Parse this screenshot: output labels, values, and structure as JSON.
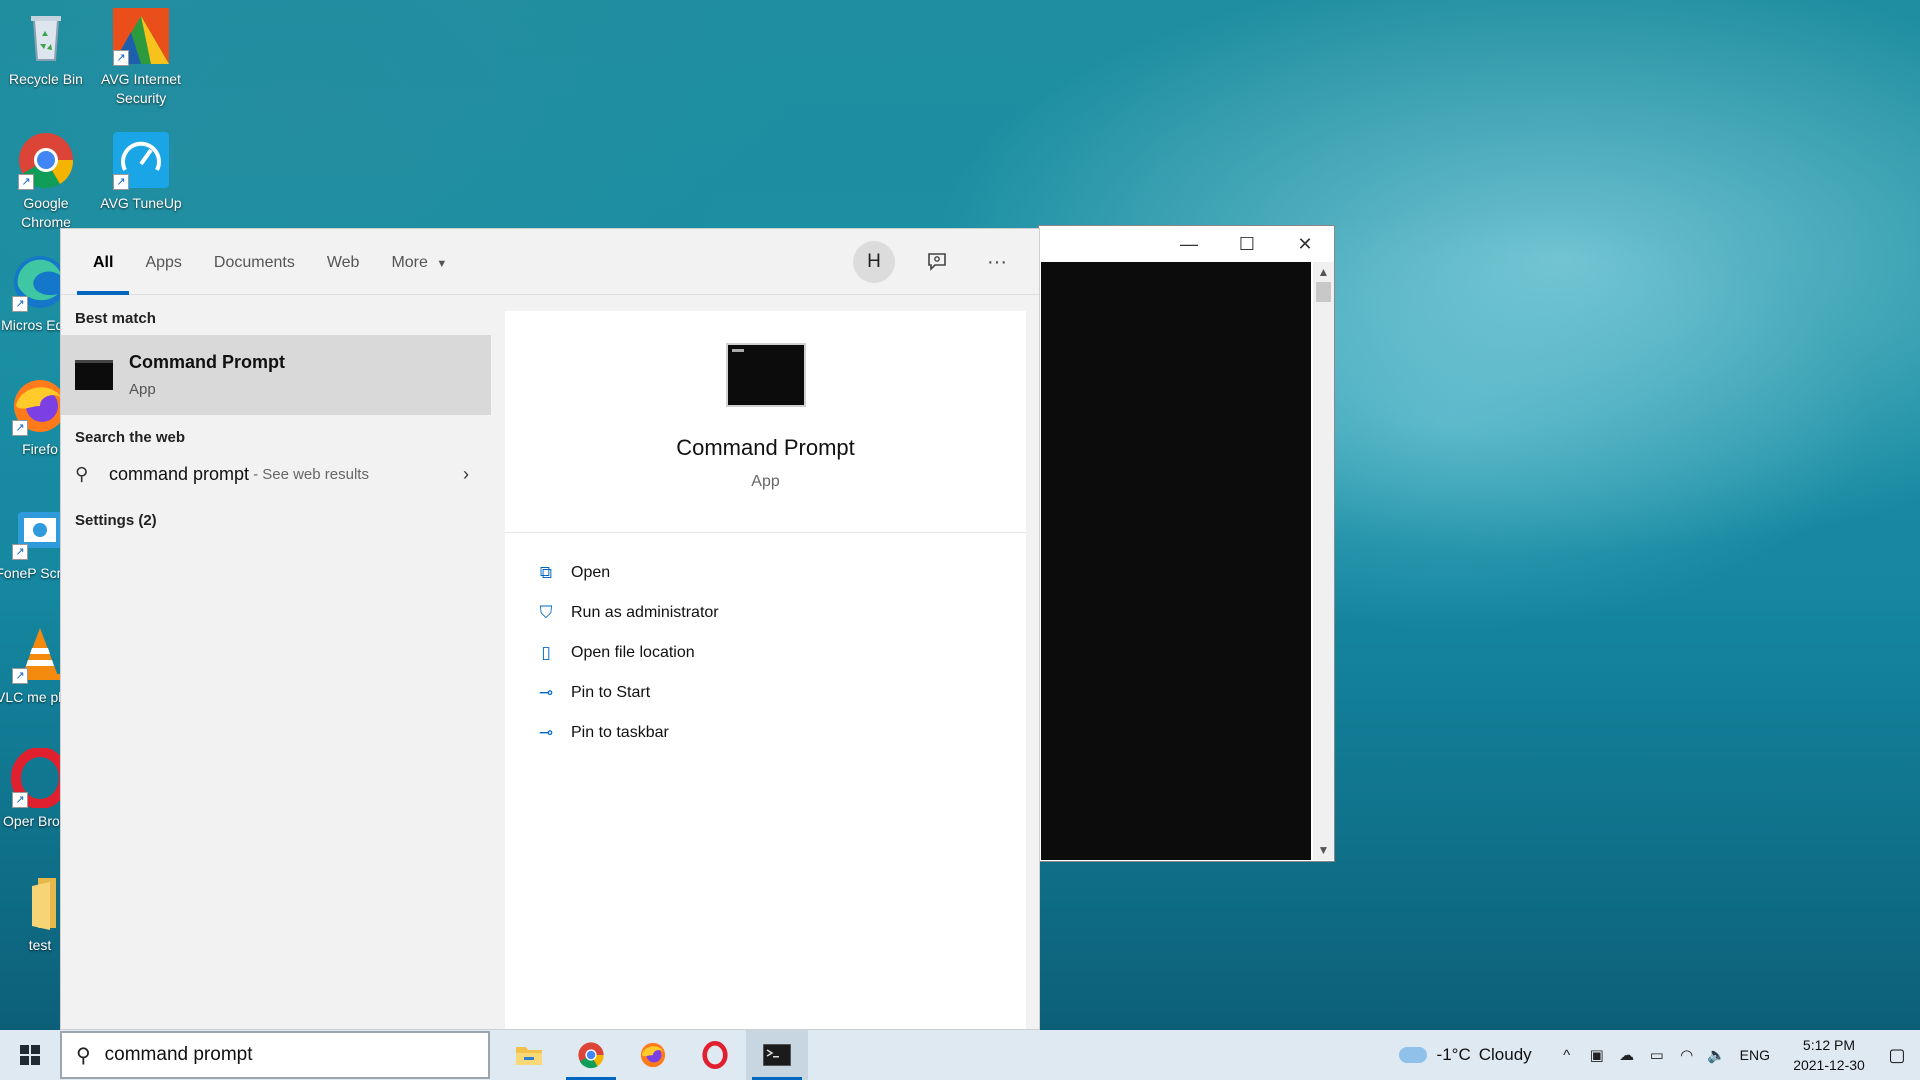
{
  "desktop": {
    "icons": [
      {
        "label": "Recycle Bin",
        "icon": "recycle-bin-icon"
      },
      {
        "label": "AVG Internet Security",
        "icon": "avg-internet-security-icon"
      },
      {
        "label": "Google Chrome",
        "icon": "chrome-icon"
      },
      {
        "label": "AVG TuneUp",
        "icon": "avg-tuneup-icon"
      },
      {
        "label": "Micros Edge",
        "icon": "edge-icon"
      },
      {
        "label": "Firefo",
        "icon": "firefox-icon"
      },
      {
        "label": "FoneP Screen",
        "icon": "fonepaw-icon"
      },
      {
        "label": "VLC me playe",
        "icon": "vlc-icon"
      },
      {
        "label": "Oper Brows",
        "icon": "opera-icon"
      },
      {
        "label": "test",
        "icon": "folder-icon"
      }
    ]
  },
  "search_panel": {
    "tabs": [
      {
        "label": "All",
        "active": true
      },
      {
        "label": "Apps"
      },
      {
        "label": "Documents"
      },
      {
        "label": "Web"
      },
      {
        "label": "More"
      }
    ],
    "avatar_initial": "H",
    "best_match": {
      "heading": "Best match",
      "title": "Command Prompt",
      "subtitle": "App"
    },
    "search_web": {
      "heading": "Search the web",
      "query": "command prompt",
      "hint": "- See web results"
    },
    "settings": {
      "heading": "Settings (2)"
    },
    "detail": {
      "title": "Command Prompt",
      "subtitle": "App",
      "actions": [
        {
          "label": "Open",
          "icon": "open-icon"
        },
        {
          "label": "Run as administrator",
          "icon": "shield-icon"
        },
        {
          "label": "Open file location",
          "icon": "file-location-icon"
        },
        {
          "label": "Pin to Start",
          "icon": "pin-icon"
        },
        {
          "label": "Pin to taskbar",
          "icon": "pin-icon"
        }
      ]
    }
  },
  "taskbar": {
    "search_value": "command prompt",
    "apps": [
      {
        "name": "File Explorer",
        "icon": "file-explorer-icon"
      },
      {
        "name": "Google Chrome",
        "icon": "chrome-icon",
        "running": true
      },
      {
        "name": "Firefox",
        "icon": "firefox-icon"
      },
      {
        "name": "Opera",
        "icon": "opera-icon"
      },
      {
        "name": "Command Prompt",
        "icon": "cmd-icon",
        "running": true,
        "active": true
      }
    ],
    "weather": {
      "temp": "-1°C",
      "condition": "Cloudy"
    },
    "language": "ENG",
    "time": "5:12 PM",
    "date": "2021-12-30"
  },
  "colors": {
    "accent": "#0067c0",
    "panel_bg": "#f2f2f2",
    "selected_bg": "#d9d9d9",
    "taskbar_bg": "#dfe9f1"
  }
}
